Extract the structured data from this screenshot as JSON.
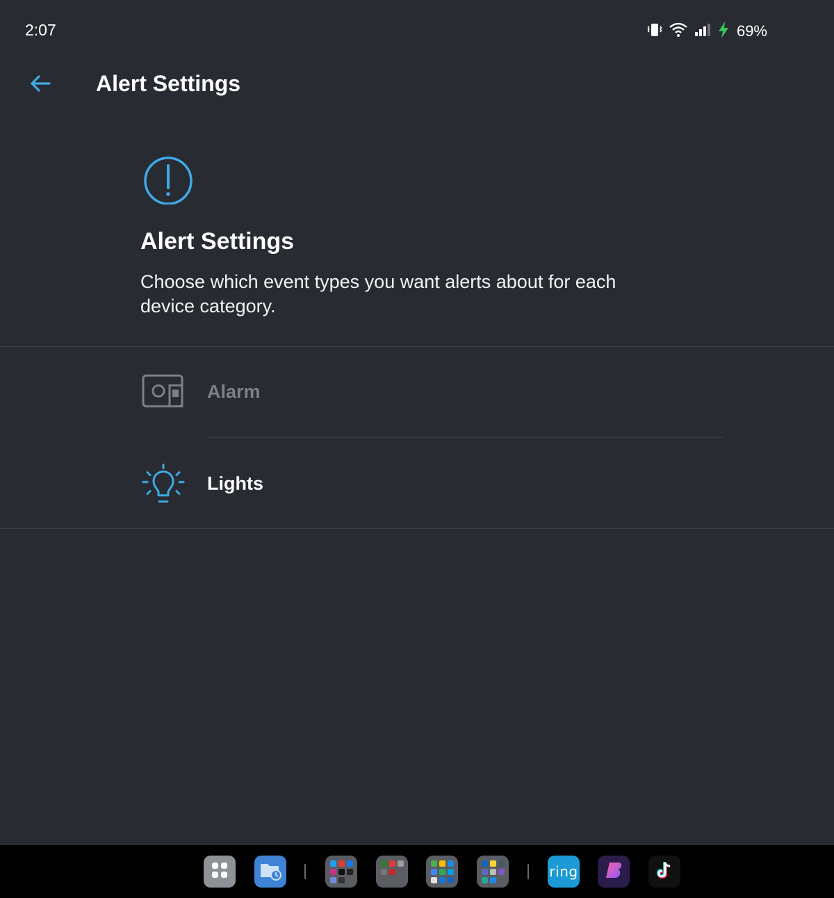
{
  "status_bar": {
    "time": "2:07",
    "battery_percent": "69%",
    "icons": [
      "vibrate-icon",
      "wifi-icon",
      "signal-icon",
      "charging-bolt-icon"
    ]
  },
  "app_bar": {
    "title": "Alert Settings",
    "back_icon": "arrow-left-icon"
  },
  "header": {
    "icon": "alert-circle-icon",
    "title": "Alert Settings",
    "description": "Choose which event types you want alerts about for each device category."
  },
  "categories": [
    {
      "label": "Alarm",
      "icon": "alarm-base-station-icon",
      "enabled": false
    },
    {
      "label": "Lights",
      "icon": "lightbulb-icon",
      "enabled": true
    }
  ],
  "taskbar": {
    "items": [
      {
        "name": "app-drawer",
        "icon": "grid-icon"
      },
      {
        "name": "files",
        "icon": "folder-clock-icon"
      },
      {
        "name": "social-folder",
        "icon": "app-folder-icon"
      },
      {
        "name": "tools-folder",
        "icon": "app-folder-icon"
      },
      {
        "name": "google-folder",
        "icon": "app-folder-icon"
      },
      {
        "name": "misc-folder",
        "icon": "app-folder-icon"
      },
      {
        "name": "ring-app",
        "label": "ring"
      },
      {
        "name": "bluesky-like-app",
        "icon": "b-logo-icon"
      },
      {
        "name": "tiktok-app",
        "icon": "tiktok-icon"
      }
    ]
  },
  "colors": {
    "background": "#282b31",
    "accent": "#3ea9e6",
    "disabled_text": "#7c8088",
    "charging_green": "#34c759",
    "taskbar": "#000000"
  }
}
